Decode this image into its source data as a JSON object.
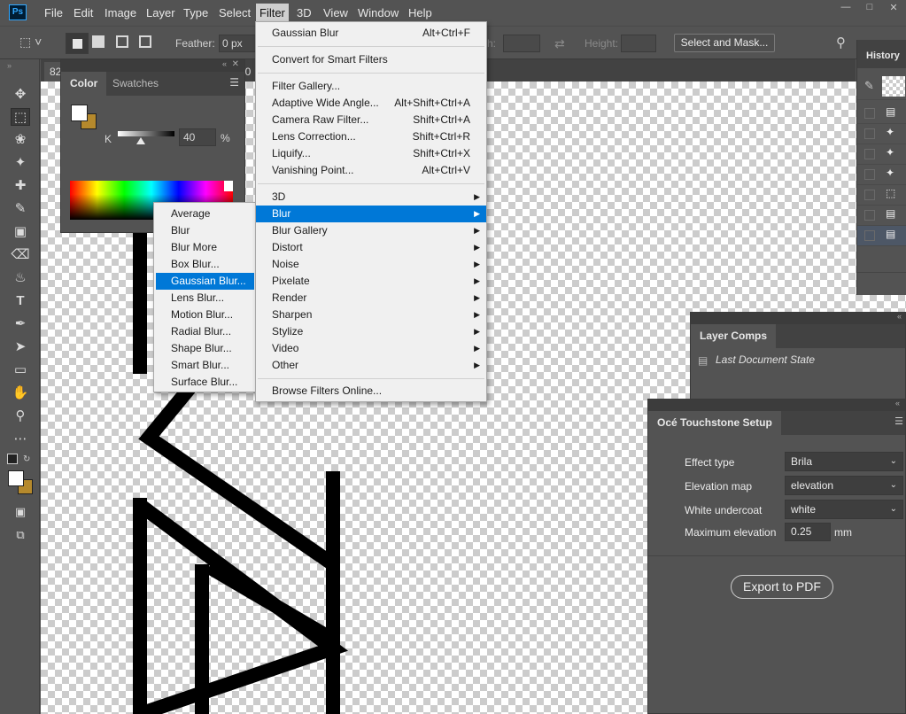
{
  "menubar": {
    "items": [
      "File",
      "Edit",
      "Image",
      "Layer",
      "Type",
      "Select",
      "Filter",
      "3D",
      "View",
      "Window",
      "Help"
    ],
    "active": "Filter",
    "logo": "Ps"
  },
  "options_bar": {
    "feather_label": "Feather:",
    "feather_value": "0 px",
    "width_label": "Width:",
    "height_label": "Height:",
    "select_mask_label": "Select and Mask..."
  },
  "document": {
    "tab_zoom": "82",
    "tab_fragment": "10"
  },
  "color_panel": {
    "tabs": [
      "Color",
      "Swatches"
    ],
    "active_tab": "Color",
    "slider_label": "K",
    "slider_value": "40",
    "unit": "%",
    "k_level_percent": 40,
    "foreground_color": "#ffffff",
    "background_color": "#b5892c"
  },
  "filter_menu": {
    "items": [
      {
        "label": "Gaussian Blur",
        "shortcut": "Alt+Ctrl+F"
      },
      {
        "label": "Convert for Smart Filters",
        "shortcut": ""
      },
      {
        "label": "Filter Gallery...",
        "shortcut": ""
      },
      {
        "label": "Adaptive Wide Angle...",
        "shortcut": "Alt+Shift+Ctrl+A"
      },
      {
        "label": "Camera Raw Filter...",
        "shortcut": "Shift+Ctrl+A"
      },
      {
        "label": "Lens Correction...",
        "shortcut": "Shift+Ctrl+R"
      },
      {
        "label": "Liquify...",
        "shortcut": "Shift+Ctrl+X"
      },
      {
        "label": "Vanishing Point...",
        "shortcut": "Alt+Ctrl+V"
      },
      {
        "label": "3D",
        "submenu": true
      },
      {
        "label": "Blur",
        "submenu": true,
        "highlighted": true
      },
      {
        "label": "Blur Gallery",
        "submenu": true
      },
      {
        "label": "Distort",
        "submenu": true
      },
      {
        "label": "Noise",
        "submenu": true
      },
      {
        "label": "Pixelate",
        "submenu": true
      },
      {
        "label": "Render",
        "submenu": true
      },
      {
        "label": "Sharpen",
        "submenu": true
      },
      {
        "label": "Stylize",
        "submenu": true
      },
      {
        "label": "Video",
        "submenu": true
      },
      {
        "label": "Other",
        "submenu": true
      },
      {
        "label": "Browse Filters Online..."
      }
    ]
  },
  "blur_submenu": {
    "items": [
      "Average",
      "Blur",
      "Blur More",
      "Box Blur...",
      "Gaussian Blur...",
      "Lens Blur...",
      "Motion Blur...",
      "Radial Blur...",
      "Shape Blur...",
      "Smart Blur...",
      "Surface Blur..."
    ],
    "highlighted": "Gaussian Blur..."
  },
  "history_panel": {
    "title": "History"
  },
  "layer_comps": {
    "tab": "Layer Comps",
    "item": "Last Document State"
  },
  "oce_panel": {
    "tab": "Océ Touchstone Setup",
    "effect_type_label": "Effect type",
    "effect_type_value": "Brila",
    "elevation_map_label": "Elevation map",
    "elevation_map_value": "elevation",
    "white_undercoat_label": "White undercoat",
    "white_undercoat_value": "white",
    "max_elevation_label": "Maximum elevation",
    "max_elevation_value": "0.25",
    "max_elevation_unit": "mm",
    "export_label": "Export to PDF"
  },
  "colors": {
    "menu_highlight": "#0078d7",
    "ui_bg": "#535353",
    "panel_dark": "#424242"
  }
}
